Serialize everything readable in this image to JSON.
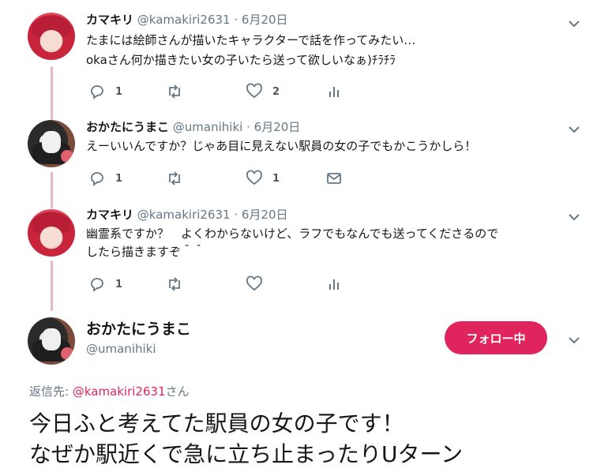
{
  "colors": {
    "accent": "#e0245e",
    "thread_line": "#e6b8c2",
    "secondary_text": "#657786"
  },
  "tweets": [
    {
      "name": "カマキリ",
      "handle": "@kamakiri2631",
      "dot": "·",
      "date": "6月20日",
      "lines": [
        "たまには絵師さんが描いたキャラクターで話を作ってみたい…",
        "okaさん何か描きたい女の子いたら送って欲しいなぁ)ﾁﾗﾁﾗ"
      ],
      "reply_count": "1",
      "retweet_count": "",
      "like_count": "2",
      "last_action_icon": "analytics-icon"
    },
    {
      "name": "おかたにうまこ",
      "handle": "@umanihiki",
      "dot": "·",
      "date": "6月20日",
      "lines": [
        "えーいいんですか？じゃあ目に見えない駅員の女の子でもかこうかしら！"
      ],
      "reply_count": "1",
      "retweet_count": "",
      "like_count": "1",
      "last_action_icon": "message-icon"
    },
    {
      "name": "カマキリ",
      "handle": "@kamakiri2631",
      "dot": "·",
      "date": "6月20日",
      "lines": [
        "幽霊系ですか？　よくわからないけど、ラフでもなんでも送ってくださるので",
        "したら描きますぞ＾＾"
      ],
      "reply_count": "1",
      "retweet_count": "",
      "like_count": "",
      "last_action_icon": "analytics-icon"
    }
  ],
  "main_tweet": {
    "name": "おかたにうまこ",
    "handle": "@umanihiki",
    "follow_label": "フォロー中",
    "reply_prefix": "返信先: ",
    "reply_mention": "@kamakiri2631",
    "reply_suffix": "さん",
    "lines": [
      "今日ふと考えてた駅員の女の子です！",
      "なぜか駅近くで急に立ち止まったりUターン"
    ]
  }
}
